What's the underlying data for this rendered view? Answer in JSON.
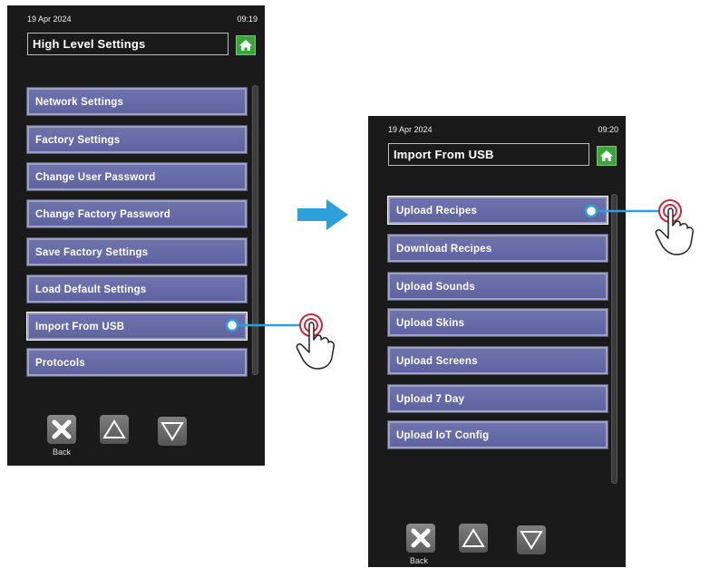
{
  "screen1": {
    "date": "19 Apr 2024",
    "time": "09:19",
    "title": "High Level Settings",
    "menu": [
      "Network Settings",
      "Factory Settings",
      "Change User Password",
      "Change Factory Password",
      "Save Factory Settings",
      "Load Default Settings",
      "Import From USB",
      "Protocols"
    ],
    "back_label": "Back"
  },
  "screen2": {
    "date": "19 Apr 2024",
    "time": "09:20",
    "title": "Import From USB",
    "menu": [
      "Upload Recipes",
      "Download Recipes",
      "Upload Sounds",
      "Upload Skins",
      "Upload Screens",
      "Upload 7 Day",
      "Upload IoT Config"
    ],
    "back_label": "Back"
  },
  "colors": {
    "accent_blue": "#2d9fd9",
    "home_green": "#3aa53a",
    "button_purple": "#6a6eaa",
    "touch_red": "#d0243c"
  },
  "icons": {
    "home": "home-icon",
    "back": "close-icon",
    "up": "triangle-up-icon",
    "down": "triangle-down-icon",
    "transition": "arrow-right-icon",
    "touch": "pointing-hand-icon"
  }
}
